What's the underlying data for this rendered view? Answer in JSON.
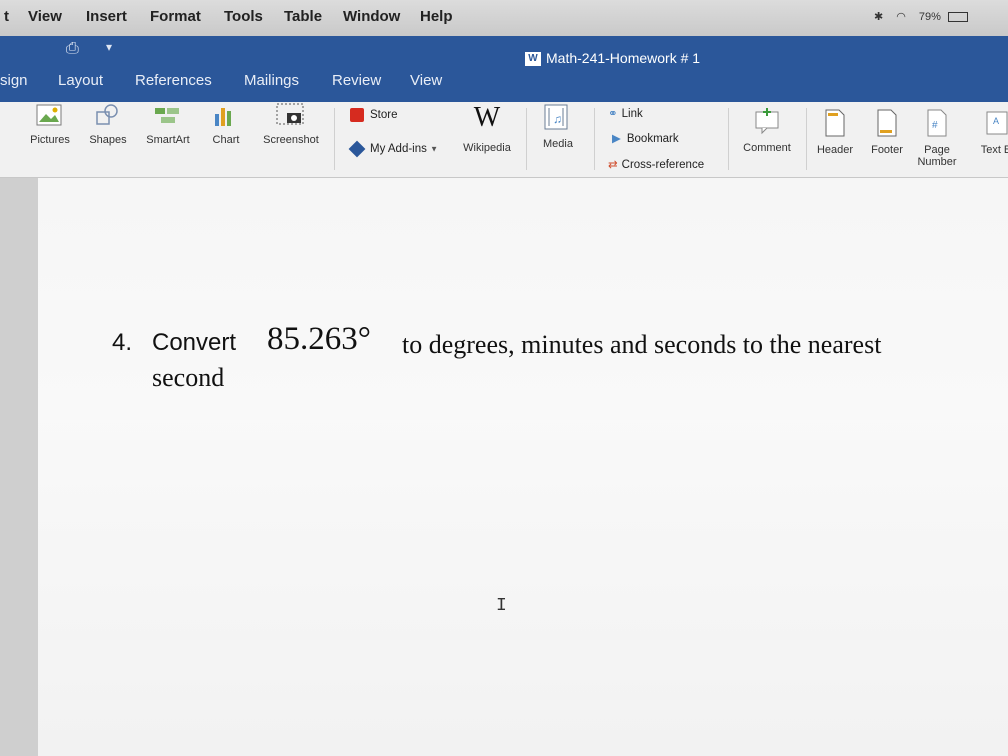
{
  "menu_bar": {
    "items": [
      "t",
      "View",
      "Insert",
      "Format",
      "Tools",
      "Table",
      "Window",
      "Help"
    ],
    "battery": "79%"
  },
  "window": {
    "doc_title": "Math-241-Homework # 1",
    "doc_icon": "W"
  },
  "tabs": [
    "sign",
    "Layout",
    "References",
    "Mailings",
    "Review",
    "View"
  ],
  "ribbon": {
    "pictures": "Pictures",
    "shapes": "Shapes",
    "smartart": "SmartArt",
    "chart": "Chart",
    "screenshot": "Screenshot",
    "store": "Store",
    "my_addins": "My Add-ins",
    "wikipedia_glyph": "W",
    "wikipedia": "Wikipedia",
    "media": "Media",
    "link": "Link",
    "bookmark": "Bookmark",
    "cross_reference": "Cross-reference",
    "comment": "Comment",
    "header": "Header",
    "footer": "Footer",
    "page_number": "Page Number",
    "text_box": "Text B"
  },
  "document": {
    "question_number": "4.",
    "verb": "Convert",
    "value": "85.263°",
    "rest_line1": "to degrees, minutes and seconds to the nearest",
    "line2": "second"
  },
  "colors": {
    "word_blue": "#2b579a",
    "ribbon_bg": "#f1f1f1",
    "page_bg": "#f7f7f7"
  }
}
